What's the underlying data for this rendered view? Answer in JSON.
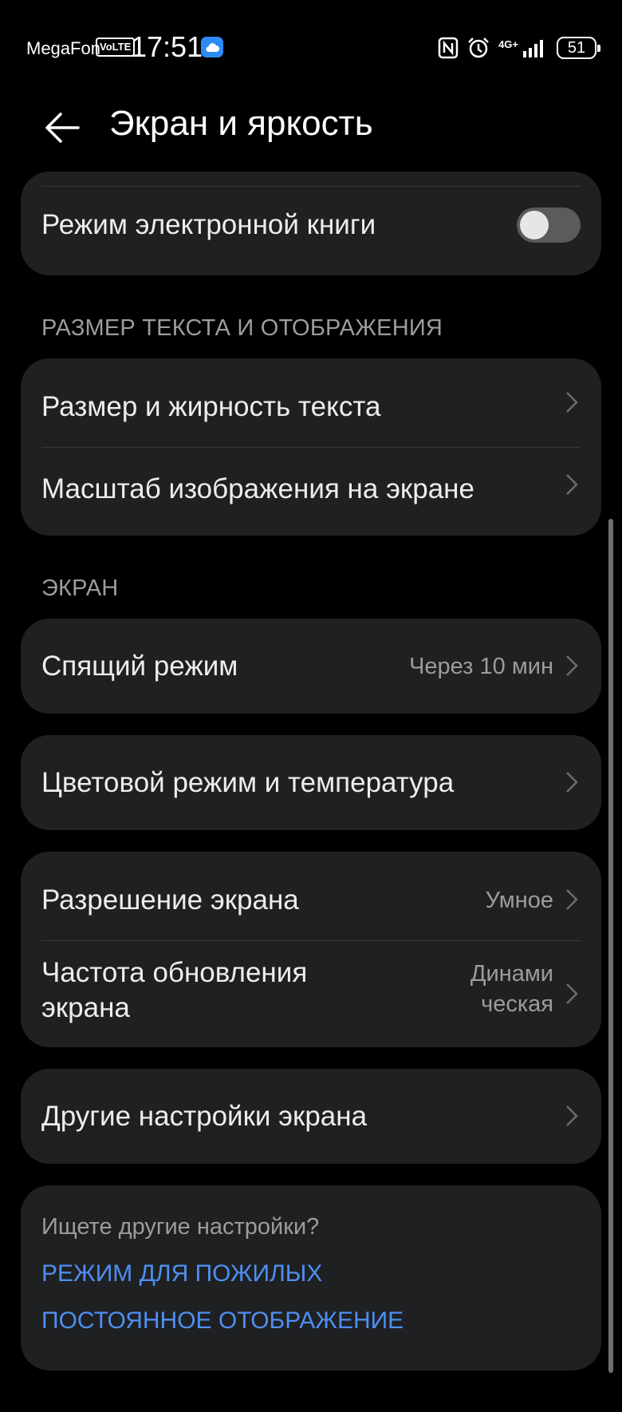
{
  "status_bar": {
    "carrier": "MegaFon",
    "volte": "VoLTE",
    "time": "17:51",
    "network": "4G+",
    "battery": "51"
  },
  "header": {
    "title": "Экран и яркость"
  },
  "ebook": {
    "label": "Режим электронной книги",
    "enabled": false
  },
  "section_text_display": {
    "title": "РАЗМЕР ТЕКСТА И ОТОБРАЖЕНИЯ",
    "items": [
      {
        "label": "Размер и жирность текста"
      },
      {
        "label": "Масштаб изображения на экране"
      }
    ]
  },
  "section_screen": {
    "title": "ЭКРАН",
    "sleep": {
      "label": "Спящий режим",
      "value": "Через 10 мин"
    },
    "color": {
      "label": "Цветовой режим и температура"
    },
    "resolution": {
      "label": "Разрешение экрана",
      "value": "Умное"
    },
    "refresh": {
      "label_line1": "Частота обновления",
      "label_line2": "экрана",
      "value_line1": "Динами",
      "value_line2": "ческая"
    },
    "other": {
      "label": "Другие настройки экрана"
    }
  },
  "suggestions": {
    "prompt": "Ищете другие настройки?",
    "links": [
      "РЕЖИМ ДЛЯ ПОЖИЛЫХ",
      "ПОСТОЯННОЕ ОТОБРАЖЕНИЕ"
    ]
  },
  "colors": {
    "background": "#000000",
    "card": "#1F2022",
    "link": "#4E8FF2",
    "secondary_text": "#9C9C9C"
  }
}
